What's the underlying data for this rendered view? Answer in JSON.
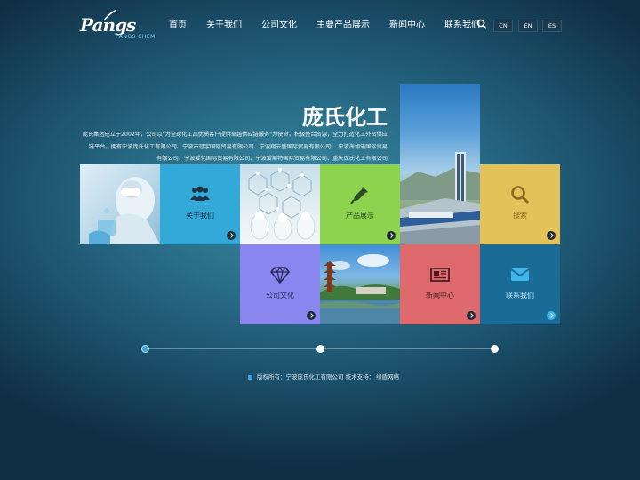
{
  "header": {
    "logo_text": "Pangs",
    "logo_sub": "PANGS CHEM",
    "nav": [
      "首页",
      "关于我们",
      "公司文化",
      "主要产品展示",
      "新闻中心",
      "联系我们"
    ],
    "languages": [
      "CN",
      "EN",
      "ES"
    ]
  },
  "hero": {
    "title": "庞氏化工",
    "intro_lines": [
      "庞氏集团成立于2002年，公司以\"为全球化工品优质客户提供卓越供应链服务\"为使命，积极整合资源，全力打造化工外贸供应",
      "链平台。拥有宁波庞氏化工有限公司、宁波市冠宇国际贸易有限公司、宁波翔云盛国际贸易有限公司 、宁波海翎诺国际贸易",
      "有限公司、宁波爱化国际贸易有限公司、宁波爱斯特国际贸易有限公司、重庆庞氏化工有限公司"
    ]
  },
  "tiles": {
    "about": "关于我们",
    "products": "产品展示",
    "search": "搜索",
    "culture": "公司文化",
    "news": "新闻中心",
    "contact": "联系我们"
  },
  "colors": {
    "about": "#33a9d9",
    "products": "#8ed34e",
    "search": "#e4c25a",
    "culture": "#8a86ef",
    "news": "#df6a6e",
    "contact": "#1a6c96"
  },
  "footer": {
    "text": "版权所有：宁波庞氏化工有限公司 技术支持： 绿盾网络"
  }
}
